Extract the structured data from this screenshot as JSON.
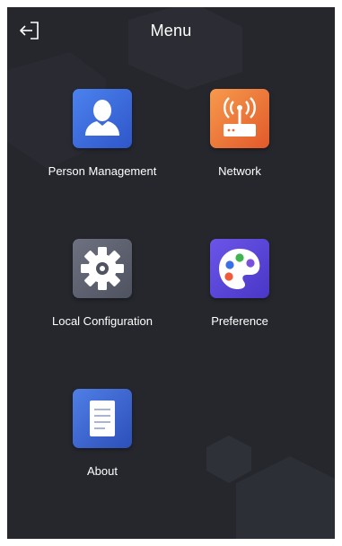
{
  "header": {
    "title": "Menu",
    "back_icon": "logout-arrow-icon"
  },
  "colors": {
    "background": "#25272d",
    "person_management": "#3f6fe0",
    "network": "#f07a3a",
    "local_configuration": "#5e6270",
    "preference": "#5b47d6",
    "about": "#3d67c9"
  },
  "menu": {
    "items": [
      {
        "label": "Person Management",
        "icon": "person-icon"
      },
      {
        "label": "Network",
        "icon": "router-icon"
      },
      {
        "label": "Local Configuration",
        "icon": "gear-icon"
      },
      {
        "label": "Preference",
        "icon": "palette-icon"
      },
      {
        "label": "About",
        "icon": "document-icon"
      }
    ]
  }
}
